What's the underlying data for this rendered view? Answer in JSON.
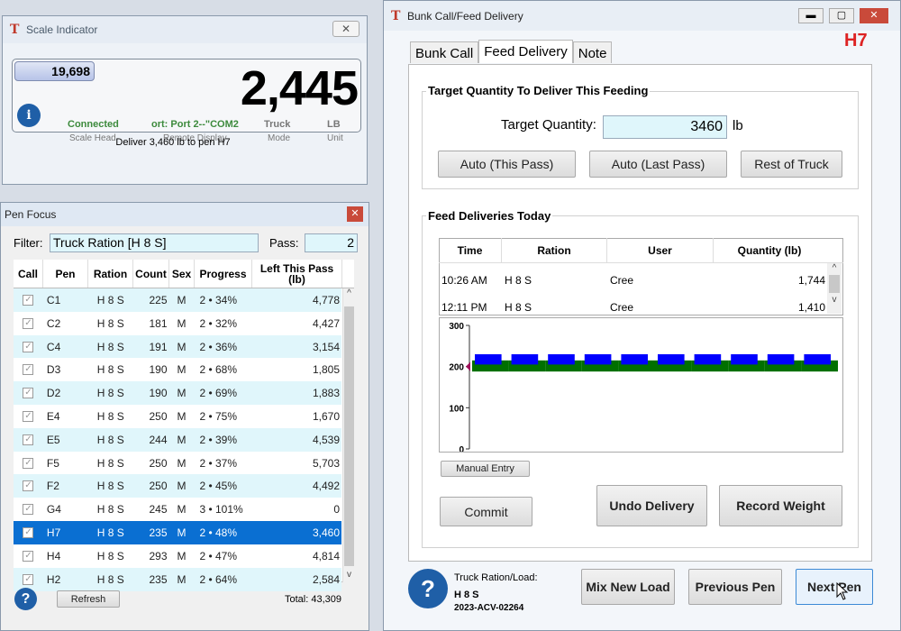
{
  "scale_indicator": {
    "title": "Scale Indicator",
    "small_weight": "19,698",
    "weight": "2,445",
    "info_icon_char": "i",
    "status": [
      {
        "value": "Connected",
        "label": "Scale Head"
      },
      {
        "value": "ort: Port 2--\"COM2",
        "label": "Remote Display"
      },
      {
        "value": "Truck",
        "label": "Mode"
      },
      {
        "value": "LB",
        "label": "Unit"
      }
    ],
    "message": "Deliver 3,460 lb to pen H7"
  },
  "pen_focus": {
    "title": "Pen Focus",
    "filter_label": "Filter:",
    "filter_value": "Truck Ration [H 8 S]",
    "pass_label": "Pass:",
    "pass_value": "2",
    "columns": [
      "Call",
      "Pen",
      "Ration",
      "Count",
      "Sex",
      "Progress",
      "Left This Pass (lb)"
    ],
    "rows": [
      {
        "pen": "C1",
        "ration": "H 8 S",
        "count": "225",
        "sex": "M",
        "progress": "2 • 34%",
        "left": "4,778"
      },
      {
        "pen": "C2",
        "ration": "H 8 S",
        "count": "181",
        "sex": "M",
        "progress": "2 • 32%",
        "left": "4,427"
      },
      {
        "pen": "C4",
        "ration": "H 8 S",
        "count": "191",
        "sex": "M",
        "progress": "2 • 36%",
        "left": "3,154"
      },
      {
        "pen": "D3",
        "ration": "H 8 S",
        "count": "190",
        "sex": "M",
        "progress": "2 • 68%",
        "left": "1,805"
      },
      {
        "pen": "D2",
        "ration": "H 8 S",
        "count": "190",
        "sex": "M",
        "progress": "2 • 69%",
        "left": "1,883"
      },
      {
        "pen": "E4",
        "ration": "H 8 S",
        "count": "250",
        "sex": "M",
        "progress": "2 • 75%",
        "left": "1,670"
      },
      {
        "pen": "E5",
        "ration": "H 8 S",
        "count": "244",
        "sex": "M",
        "progress": "2 • 39%",
        "left": "4,539"
      },
      {
        "pen": "F5",
        "ration": "H 8 S",
        "count": "250",
        "sex": "M",
        "progress": "2 • 37%",
        "left": "5,703"
      },
      {
        "pen": "F2",
        "ration": "H 8 S",
        "count": "250",
        "sex": "M",
        "progress": "2 • 45%",
        "left": "4,492"
      },
      {
        "pen": "G4",
        "ration": "H 8 S",
        "count": "245",
        "sex": "M",
        "progress": "3 • 101%",
        "left": "0"
      },
      {
        "pen": "H7",
        "ration": "H 8 S",
        "count": "235",
        "sex": "M",
        "progress": "2 • 48%",
        "left": "3,460",
        "selected": true
      },
      {
        "pen": "H4",
        "ration": "H 8 S",
        "count": "293",
        "sex": "M",
        "progress": "2 • 47%",
        "left": "4,814"
      },
      {
        "pen": "H2",
        "ration": "H 8 S",
        "count": "235",
        "sex": "M",
        "progress": "2 • 64%",
        "left": "2,584"
      }
    ],
    "help_char": "?",
    "refresh_label": "Refresh",
    "total": "Total: 43,309"
  },
  "bunk": {
    "title": "Bunk Call/Feed Delivery",
    "pen": "H7",
    "tabs": [
      "Bunk Call",
      "Feed Delivery",
      "Note"
    ],
    "target_group": "Target Quantity To Deliver This Feeding",
    "target_label": "Target Quantity:",
    "target_value": "3460",
    "target_unit": "lb",
    "auto_this": "Auto (This Pass)",
    "auto_last": "Auto (Last Pass)",
    "rest_truck": "Rest of Truck",
    "deliveries_group": "Feed Deliveries Today",
    "columns": [
      "Time",
      "Ration",
      "User",
      "Quantity (lb)"
    ],
    "deliveries": [
      {
        "time": "10:26 AM",
        "ration": "H 8 S",
        "user": "Cree",
        "qty": "1,744"
      },
      {
        "time": "12:11 PM",
        "ration": "H 8 S",
        "user": "Cree",
        "qty": "1,410"
      }
    ],
    "manual_entry": "Manual Entry",
    "commit": "Commit",
    "undo": "Undo Delivery",
    "record": "Record Weight",
    "load_label": "Truck Ration/Load:",
    "load_ration": "H 8 S",
    "load_id": "2023-ACV-02264",
    "mix_new": "Mix New Load",
    "prev_pen": "Previous Pen",
    "next_pen": "Next Pen",
    "help_char": "?"
  },
  "chart_data": {
    "type": "bar",
    "ylim": [
      0,
      300
    ],
    "yticks": [
      "300",
      "200",
      "100",
      "0"
    ],
    "bar_count": 10,
    "series": [
      {
        "values": [
          200,
          200,
          200,
          200,
          200,
          200,
          200,
          200,
          200,
          200
        ],
        "color": "#007000"
      },
      {
        "values": [
          230,
          230,
          230,
          230,
          230,
          230,
          230,
          230,
          230,
          230
        ],
        "color": "#0000ff"
      }
    ],
    "marker_value": 200
  }
}
